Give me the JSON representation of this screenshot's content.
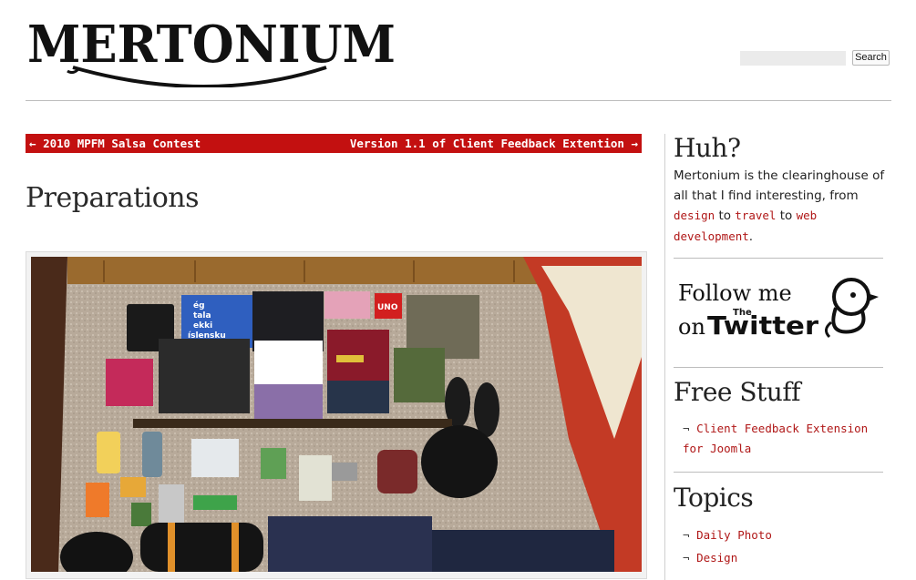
{
  "site": {
    "logo_text": "MERTONIUM"
  },
  "search": {
    "placeholder": "",
    "value": "",
    "button_label": "Search"
  },
  "post_nav": {
    "prev_arrow": "←",
    "prev_label": "2010 MPFM Salsa Contest",
    "next_label": "Version 1.1 of Client Feedback Extention",
    "next_arrow": "→"
  },
  "post": {
    "title": "Preparations",
    "photo": {
      "shirt_text": [
        "ég",
        "tala",
        "ekki",
        "íslensku"
      ],
      "book_label": "UNO"
    }
  },
  "sidebar": {
    "about": {
      "title": "Huh?",
      "text_1": "Mertonium is the clearinghouse of all that I find interesting, from ",
      "link_design": "design",
      "text_2": " to ",
      "link_travel": "travel",
      "text_3": " to ",
      "link_web": "web development",
      "text_4": "."
    },
    "twitter_badge": {
      "line1": "Follow me",
      "on": "on",
      "the": "The",
      "twitter": "Twitter"
    },
    "free_stuff": {
      "title": "Free Stuff",
      "bullet": "¬",
      "items": [
        {
          "label": "Client Feedback Extension for Joomla"
        }
      ]
    },
    "topics": {
      "title": "Topics",
      "bullet": "¬",
      "items": [
        {
          "label": "Daily Photo"
        },
        {
          "label": "Design"
        }
      ]
    }
  },
  "colors": {
    "accent_red": "#c31010",
    "link_red": "#b01717",
    "text": "#222222"
  }
}
